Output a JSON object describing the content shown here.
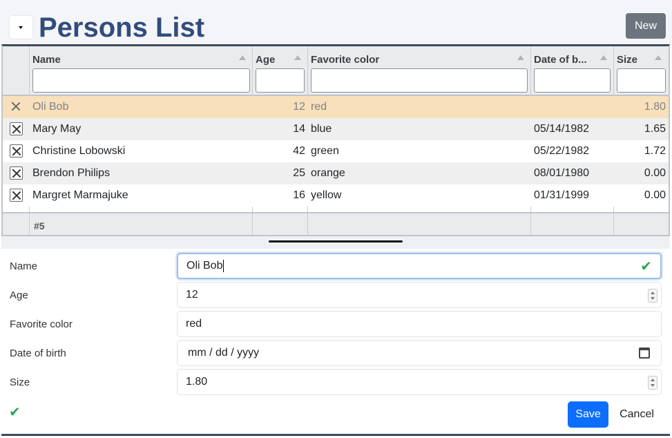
{
  "header": {
    "title": "Persons List",
    "new_label": "New"
  },
  "grid": {
    "columns": [
      {
        "label": "Name"
      },
      {
        "label": "Age"
      },
      {
        "label": "Favorite color"
      },
      {
        "label": "Date of b..."
      },
      {
        "label": "Size"
      }
    ],
    "rows": [
      {
        "name": "Oli Bob",
        "age": "12",
        "color": "red",
        "dob": "",
        "size": "1.80",
        "selected": true
      },
      {
        "name": "Mary May",
        "age": "14",
        "color": "blue",
        "dob": "05/14/1982",
        "size": "1.65"
      },
      {
        "name": "Christine Lobowski",
        "age": "42",
        "color": "green",
        "dob": "05/22/1982",
        "size": "1.72"
      },
      {
        "name": "Brendon Philips",
        "age": "25",
        "color": "orange",
        "dob": "08/01/1980",
        "size": "0.00"
      },
      {
        "name": "Margret Marmajuke",
        "age": "16",
        "color": "yellow",
        "dob": "01/31/1999",
        "size": "0.00"
      }
    ],
    "footer_count": "#5"
  },
  "form": {
    "fields": [
      {
        "label": "Name",
        "value": "Oli Bob"
      },
      {
        "label": "Age",
        "value": "12"
      },
      {
        "label": "Favorite color",
        "value": "red"
      },
      {
        "label": "Date of birth",
        "placeholder": "mm / dd / yyyy"
      },
      {
        "label": "Size",
        "value": "1.80"
      }
    ],
    "save_label": "Save",
    "cancel_label": "Cancel"
  },
  "icons": {
    "valid_check": "checkmark-icon",
    "row_delete": "close-icon",
    "calendar": "calendar-icon"
  },
  "colors": {
    "title": "#324c7c",
    "selected_row": "#f7e0bb",
    "save_button": "#0d6efd",
    "new_button": "#6c757d",
    "valid": "#2ea44f"
  }
}
